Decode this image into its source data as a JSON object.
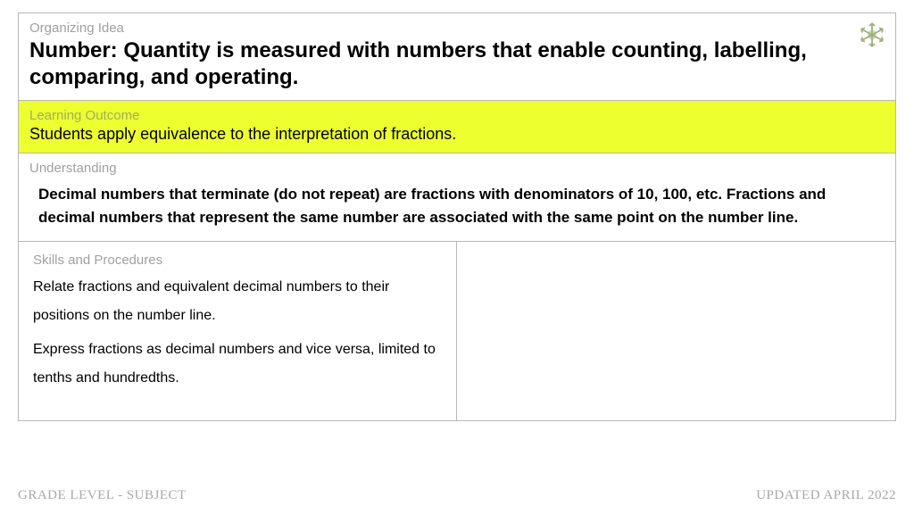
{
  "organizing": {
    "label": "Organizing Idea",
    "title": "Number: Quantity is measured with numbers that enable counting, labelling, comparing, and operating."
  },
  "learning": {
    "label": "Learning Outcome",
    "text": "Students apply equivalence to the interpretation of fractions."
  },
  "understanding": {
    "label": "Understanding",
    "text": "Decimal numbers that terminate (do not repeat) are fractions with denominators of 10, 100, etc. Fractions and decimal numbers that represent the same number are associated with the same point on the number line."
  },
  "skills": {
    "label": "Skills and Procedures",
    "item1": "Relate fractions and equivalent decimal numbers to their positions on the number line.",
    "item2": "Express fractions as decimal numbers and vice versa, limited to tenths and hundredths."
  },
  "footer": {
    "left": "GRADE LEVEL - SUBJECT",
    "right": "UPDATED APRIL 2022"
  },
  "colors": {
    "highlight": "#edff2f",
    "border": "#b8b8b8",
    "muted": "#a0a0a0",
    "icon": "#8ca360"
  }
}
